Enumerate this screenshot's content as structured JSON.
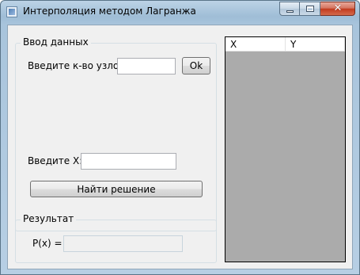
{
  "window": {
    "title": "Интерполяция методом Лагранжа",
    "close_glyph": "✕"
  },
  "input_group": {
    "title": "Ввод данных",
    "nodes_label": "Введите к-во узлов:",
    "nodes_value": "",
    "ok_label": "Ok",
    "x_label": "Введите X:",
    "x_value": "",
    "solve_label": "Найти решение"
  },
  "result_group": {
    "title": "Результат",
    "px_label": "P(x) =",
    "px_value": ""
  },
  "grid": {
    "columns": [
      "X",
      "Y"
    ],
    "rows": []
  }
}
